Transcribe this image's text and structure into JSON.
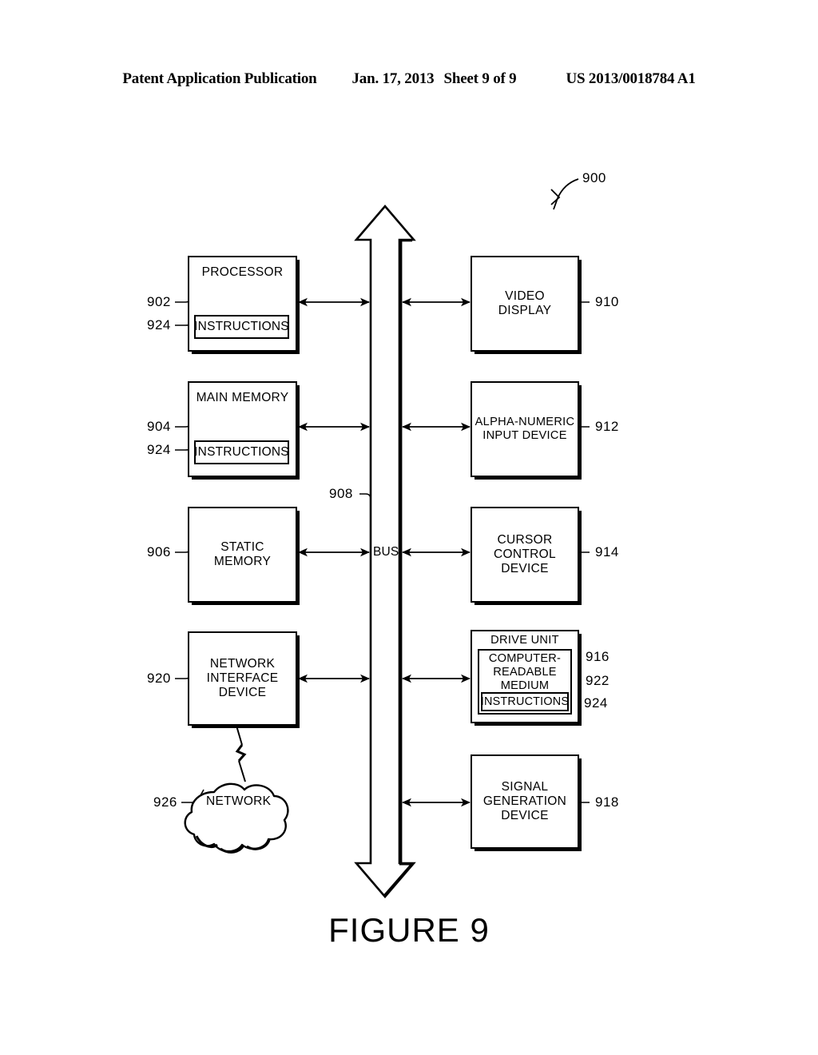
{
  "header": {
    "publication": "Patent Application Publication",
    "date": "Jan. 17, 2013",
    "sheet": "Sheet 9 of 9",
    "patent_number": "US 2013/0018784 A1"
  },
  "figure": {
    "caption": "FIGURE 9",
    "system_ref": "900",
    "bus_label": "BUS",
    "bus_ref": "908"
  },
  "blocks": {
    "processor": {
      "title": "PROCESSOR",
      "ref": "902",
      "sub_label": "INSTRUCTIONS",
      "sub_ref": "924"
    },
    "main_memory": {
      "title": "MAIN MEMORY",
      "ref": "904",
      "sub_label": "INSTRUCTIONS",
      "sub_ref": "924"
    },
    "static_memory": {
      "line1": "STATIC",
      "line2": "MEMORY",
      "ref": "906"
    },
    "network_interface": {
      "line1": "NETWORK",
      "line2": "INTERFACE",
      "line3": "DEVICE",
      "ref": "920"
    },
    "network_cloud": {
      "label": "NETWORK",
      "ref": "926"
    },
    "video_display": {
      "line1": "VIDEO",
      "line2": "DISPLAY",
      "ref": "910"
    },
    "alpha_numeric_input": {
      "line1": "ALPHA-NUMERIC",
      "line2": "INPUT DEVICE",
      "ref": "912"
    },
    "cursor_control": {
      "line1": "CURSOR",
      "line2": "CONTROL",
      "line3": "DEVICE",
      "ref": "914"
    },
    "drive_unit": {
      "title": "DRIVE UNIT",
      "ref": "916",
      "medium_line1": "COMPUTER-",
      "medium_line2": "READABLE",
      "medium_line3": "MEDIUM",
      "medium_ref": "922",
      "instructions_label": "INSTRUCTIONS",
      "instructions_ref": "924"
    },
    "signal_generation": {
      "line1": "SIGNAL",
      "line2": "GENERATION",
      "line3": "DEVICE",
      "ref": "918"
    }
  },
  "colors": {
    "ink": "#000000",
    "paper": "#ffffff"
  }
}
